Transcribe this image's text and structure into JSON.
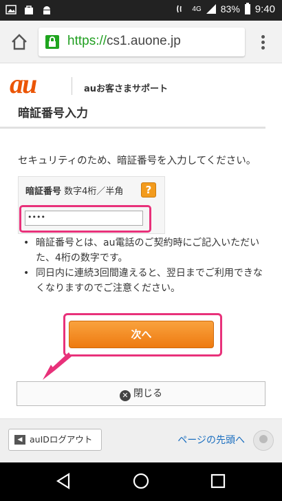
{
  "status_bar": {
    "network": "4G",
    "battery": "83%",
    "time": "9:40"
  },
  "browser": {
    "url_protocol": "https://",
    "url_host": "cs1.auone.jp"
  },
  "header": {
    "logo": "au",
    "site_title": "auお客さまサポート"
  },
  "page": {
    "title": "暗証番号入力",
    "intro": "セキュリティのため、暗証番号を入力してください。",
    "pin_label": "暗証番号",
    "pin_hint": "数字4桁／半角",
    "pin_help": "?",
    "pin_value": "••••",
    "notes": [
      "暗証番号とは、au電話のご契約時にご記入いただいた、4桁の数字です。",
      "同日内に連続3回間違えると、翌日までご利用できなくなりますのでご注意ください。"
    ],
    "next_button": "次へ",
    "close_button": "閉じる"
  },
  "footer": {
    "logout_button": "auIDログアウト",
    "back_to_top": "ページの先頭へ"
  },
  "colors": {
    "brand": "#eb5505",
    "highlight": "#e8317a",
    "button_orange": "#f39b1d",
    "link": "#1a6ebf"
  }
}
